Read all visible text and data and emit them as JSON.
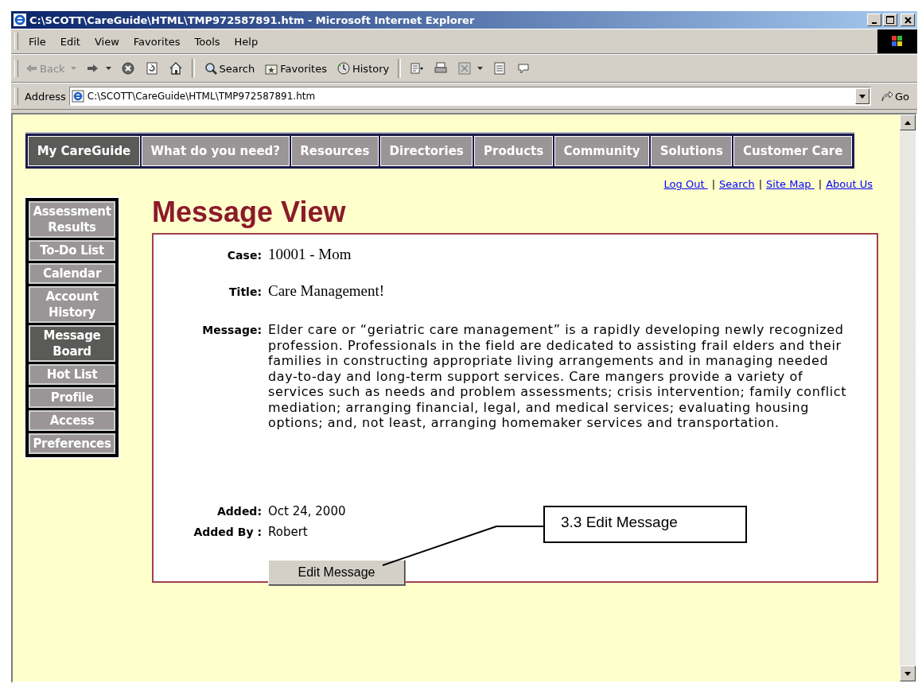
{
  "window": {
    "title": "C:\\SCOTT\\CareGuide\\HTML\\TMP972587891.htm - Microsoft Internet Explorer"
  },
  "menu": [
    "File",
    "Edit",
    "View",
    "Favorites",
    "Tools",
    "Help"
  ],
  "toolbar": [
    {
      "kind": "back",
      "label": "Back",
      "disabled": true
    },
    {
      "kind": "forward",
      "disabled": false
    },
    {
      "kind": "stop"
    },
    {
      "kind": "refresh"
    },
    {
      "kind": "home"
    },
    {
      "kind": "search",
      "label": "Search"
    },
    {
      "kind": "favorites",
      "label": "Favorites"
    },
    {
      "kind": "history",
      "label": "History"
    },
    {
      "kind": "mail"
    },
    {
      "kind": "print"
    },
    {
      "kind": "edit"
    },
    {
      "kind": "document"
    },
    {
      "kind": "discuss"
    }
  ],
  "address": {
    "label": "Address",
    "value": "C:\\SCOTT\\CareGuide\\HTML\\TMP972587891.htm",
    "go": "Go"
  },
  "nav_tabs": [
    {
      "label": "My CareGuide",
      "selected": true
    },
    {
      "label": "What do you need?",
      "selected": false
    },
    {
      "label": "Resources",
      "selected": false
    },
    {
      "label": "Directories",
      "selected": false
    },
    {
      "label": "Products",
      "selected": false
    },
    {
      "label": "Community",
      "selected": false
    },
    {
      "label": "Solutions",
      "selected": false
    },
    {
      "label": "Customer Care",
      "selected": false
    }
  ],
  "top_links": [
    {
      "kind": "link",
      "text": "Log Out "
    },
    {
      "kind": "separator",
      "text": "|"
    },
    {
      "kind": "link",
      "text": "Search"
    },
    {
      "kind": "separator",
      "text": "|"
    },
    {
      "kind": "link",
      "text": "Site Map "
    },
    {
      "kind": "separator",
      "text": "|"
    },
    {
      "kind": "link",
      "text": "About Us"
    }
  ],
  "sidebar": {
    "items": [
      {
        "label": "Assessment Results",
        "selected": false
      },
      {
        "label": "To-Do List",
        "selected": false
      },
      {
        "label": "Calendar",
        "selected": false
      },
      {
        "label": "Account History",
        "selected": false
      },
      {
        "label": "Message Board",
        "selected": true
      },
      {
        "label": "Hot List",
        "selected": false
      },
      {
        "label": "Profile",
        "selected": false
      },
      {
        "label": "Access",
        "selected": false
      },
      {
        "label": "Preferences",
        "selected": false
      }
    ]
  },
  "heading": "Message View",
  "fields": [
    {
      "label": "Case:",
      "value": "10001 - Mom",
      "kind": "serif"
    },
    {
      "label": "Title:",
      "value": "Care Management!",
      "kind": "serif"
    },
    {
      "label": "Message:",
      "value": "Elder care or “geriatric care management” is a rapidly developing newly recognized profession. Professionals in the field are dedicated to assisting frail elders and their families in constructing appropriate living arrangements and in managing needed day-to-day and long-term support services. Care mangers provide a variety of services such as needs and problem assessments; crisis intervention; family conflict mediation; arranging financial, legal, and medical services; evaluating housing options; and, not least, arranging homemaker services and transportation.",
      "kind": "long"
    },
    {
      "label": "Added:",
      "value": "Oct 24, 2000",
      "kind": "plain"
    },
    {
      "label": "Added By :",
      "value": "Robert",
      "kind": "plain"
    }
  ],
  "button": "Edit Message",
  "callout": "3.3 Edit Message"
}
